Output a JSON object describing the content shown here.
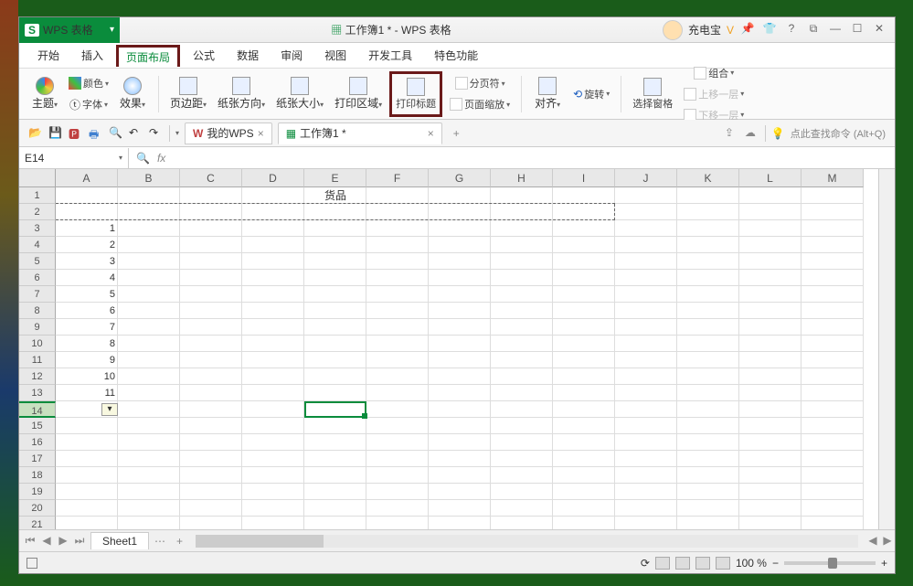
{
  "app": {
    "name": "WPS 表格",
    "logo_letter": "S"
  },
  "title": {
    "doc": "工作簿1 *",
    "suffix": " - WPS 表格"
  },
  "user": {
    "name": "充电宝",
    "badge": "V"
  },
  "menus": [
    "开始",
    "插入",
    "页面布局",
    "公式",
    "数据",
    "审阅",
    "视图",
    "开发工具",
    "特色功能"
  ],
  "active_menu_index": 2,
  "ribbon": {
    "theme": "主题",
    "font": "字体",
    "effects": "效果",
    "colors": "颜色",
    "margins": "页边距",
    "orientation": "纸张方向",
    "size": "纸张大小",
    "print_area": "打印区域",
    "print_titles": "打印标题",
    "scale": "页面缩放",
    "breaks": "分页符",
    "align": "对齐",
    "rotate": "旋转",
    "sel_pane": "选择窗格",
    "group": "组合",
    "up_layer": "上移一层",
    "down_layer": "下移一层"
  },
  "tabs": {
    "wps_home": "我的WPS",
    "doc": "工作簿1 *"
  },
  "search_hint": "点此查找命令 (Alt+Q)",
  "namebox": "E14",
  "columns": [
    "A",
    "B",
    "C",
    "D",
    "E",
    "F",
    "G",
    "H",
    "I",
    "J",
    "K",
    "L",
    "M"
  ],
  "rows_visible": 21,
  "selected_row": 14,
  "merged_header": "货品",
  "col_a_values": {
    "3": "1",
    "4": "2",
    "5": "3",
    "6": "4",
    "7": "5",
    "8": "6",
    "9": "7",
    "10": "8",
    "11": "9",
    "12": "10",
    "13": "11"
  },
  "sheet": {
    "name": "Sheet1"
  },
  "zoom": "100 %"
}
